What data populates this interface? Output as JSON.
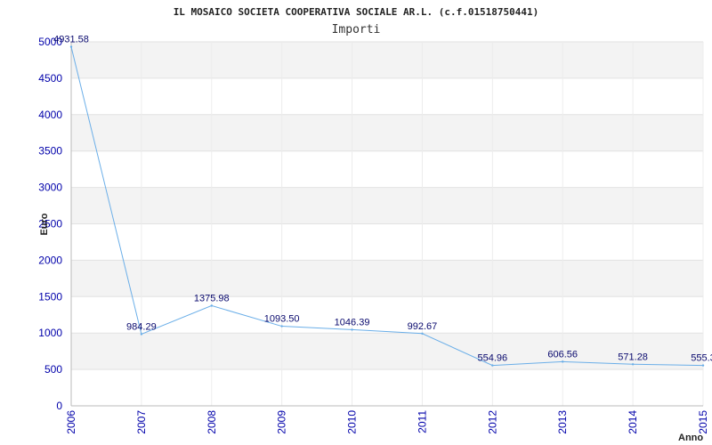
{
  "chart_data": {
    "type": "line",
    "title": "IL MOSAICO SOCIETA COOPERATIVA SOCIALE AR.L. (c.f.01518750441)",
    "subtitle": "Importi",
    "xlabel": "Anno",
    "ylabel": "Euro",
    "ylim": [
      0,
      5000
    ],
    "yticks": [
      "0",
      "500",
      "1000",
      "1500",
      "2000",
      "2500",
      "3000",
      "3500",
      "4000",
      "4500",
      "5000"
    ],
    "categories": [
      "2006",
      "2007",
      "2008",
      "2009",
      "2010",
      "2011",
      "2012",
      "2013",
      "2014",
      "2015"
    ],
    "values": [
      4931.58,
      984.29,
      1375.98,
      1093.5,
      1046.39,
      992.67,
      554.96,
      606.56,
      571.28,
      555.3
    ],
    "data_labels": [
      "4931.58",
      "984.29",
      "1375.98",
      "1093.50",
      "1046.39",
      "992.67",
      "554.96",
      "606.56",
      "571.28",
      "555.3"
    ],
    "grid": true,
    "colors": {
      "line": "#6aaee8",
      "band": "#f3f3f3",
      "tick_text": "#0000aa",
      "label_text": "#0a0a6e"
    }
  }
}
